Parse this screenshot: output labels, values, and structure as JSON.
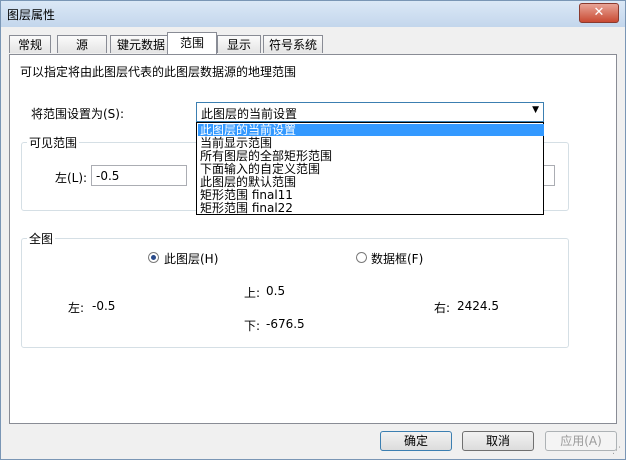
{
  "window": {
    "title": "图层属性",
    "close_label": "✕"
  },
  "tabs": [
    "常规",
    "源",
    "键元数据",
    "范围",
    "显示",
    "符号系统"
  ],
  "active_tab": 3,
  "description": "可以指定将由此图层代表的此图层数据源的地理范围",
  "extent": {
    "label": "将范围设置为(S):",
    "selected": "此图层的当前设置",
    "options": [
      "此图层的当前设置",
      "当前显示范围",
      "所有图层的全部矩形范围",
      "下面输入的自定义范围",
      "此图层的默认范围",
      "矩形范围 final11",
      "矩形范围 final22"
    ]
  },
  "visible_extent": {
    "title": "可见范围",
    "left_label": "左(L):",
    "left_value": "-0.5"
  },
  "full_extent": {
    "title": "全图",
    "radio_layer": "此图层(H)",
    "radio_frame": "数据框(F)",
    "top_label": "上:",
    "top_value": "0.5",
    "left_label": "左:",
    "left_value": "-0.5",
    "right_label": "右:",
    "right_value": "2424.5",
    "bottom_label": "下:",
    "bottom_value": "-676.5"
  },
  "buttons": {
    "ok": "确定",
    "cancel": "取消",
    "apply": "应用(A)"
  }
}
